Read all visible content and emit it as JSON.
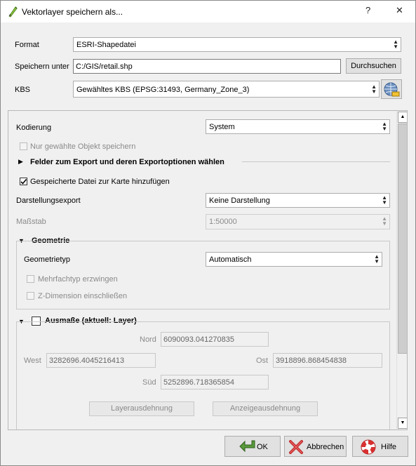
{
  "window": {
    "title": "Vektorlayer speichern als...",
    "help_glyph": "?",
    "close_glyph": "✕"
  },
  "form": {
    "format_label": "Format",
    "format_value": "ESRI-Shapedatei",
    "save_label": "Speichern unter",
    "save_value": "C:/GIS/retail.shp",
    "browse_label": "Durchsuchen",
    "crs_label": "KBS",
    "crs_value": "Gewähltes KBS (EPSG:31493, Germany_Zone_3)"
  },
  "options": {
    "encoding_label": "Kodierung",
    "encoding_value": "System",
    "selected_only_label": "Nur gewählte Objekt speichern",
    "selected_only_checked": false,
    "fields_section_label": "Felder zum Export und deren Exportoptionen wählen",
    "add_to_map_label": "Gespeicherte Datei zur Karte hinzufügen",
    "add_to_map_checked": true,
    "symbology_label": "Darstellungsexport",
    "symbology_value": "Keine Darstellung",
    "scale_label": "Maßstab",
    "scale_value": "1:50000"
  },
  "geometry": {
    "header": "Geometrie",
    "type_label": "Geometrietyp",
    "type_value": "Automatisch",
    "force_multi_label": "Mehrfachtyp erzwingen",
    "include_z_label": "Z-Dimension einschließen"
  },
  "extent": {
    "header": "Ausmaße (aktuell: Layer)",
    "north_label": "Nord",
    "north_value": "6090093.041270835",
    "west_label": "West",
    "west_value": "3282696.4045216413",
    "east_label": "Ost",
    "east_value": "3918896.868454838",
    "south_label": "Süd",
    "south_value": "5252896.718365854",
    "layer_extent_button": "Layerausdehnung",
    "canvas_extent_button": "Anzeigeausdehnung"
  },
  "buttons": {
    "ok": "OK",
    "cancel": "Abbrechen",
    "help": "Hilfe"
  },
  "colors": {
    "ok_icon": "#4a8f3a",
    "cancel_icon": "#c0282a",
    "help_icon": "#d02a2a",
    "title_icon": "#6aa520"
  }
}
